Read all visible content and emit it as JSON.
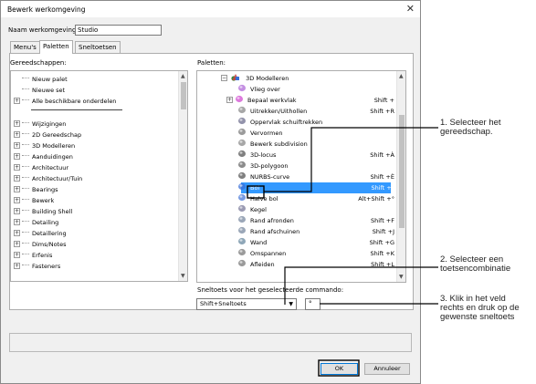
{
  "window": {
    "title": "Bewerk werkomgeving",
    "close_glyph": "✕"
  },
  "name_row": {
    "label": "Naam werkomgeving:",
    "value": "Studio"
  },
  "tabs": [
    {
      "label": "Menu's"
    },
    {
      "label": "Paletten"
    },
    {
      "label": "Sneltoetsen"
    }
  ],
  "tools_panel": {
    "label": "Gereedschappen:",
    "items": [
      {
        "label": "Nieuw palet",
        "expandable": false
      },
      {
        "label": "Nieuwe set",
        "expandable": false
      },
      {
        "label": "Alle beschikbare onderdelen",
        "expandable": true
      },
      {
        "label": "Wijzigingen",
        "expandable": true
      },
      {
        "label": "2D Gereedschap",
        "expandable": true
      },
      {
        "label": "3D Modelleren",
        "expandable": true
      },
      {
        "label": "Aanduidingen",
        "expandable": true
      },
      {
        "label": "Architectuur",
        "expandable": true
      },
      {
        "label": "Architectuur/Tuin",
        "expandable": true
      },
      {
        "label": "Bearings",
        "expandable": true
      },
      {
        "label": "Bewerk",
        "expandable": true
      },
      {
        "label": "Building Shell",
        "expandable": true
      },
      {
        "label": "Detailing",
        "expandable": true
      },
      {
        "label": "Detaillering",
        "expandable": true
      },
      {
        "label": "Dims/Notes",
        "expandable": true
      },
      {
        "label": "Erfenis",
        "expandable": true
      },
      {
        "label": "Fasteners",
        "expandable": true
      }
    ]
  },
  "palettes_panel": {
    "label": "Paletten:",
    "root": "3D Modelleren",
    "items": [
      {
        "label": "Vlieg over",
        "shortcut": "",
        "icon": "fly-over-icon",
        "expandable": false
      },
      {
        "label": "Bepaal werkvlak",
        "shortcut": "Shift +",
        "icon": "working-plane-icon",
        "expandable": true
      },
      {
        "label": "Uitrekken/Uithollen",
        "shortcut": "Shift +R",
        "icon": "extrude-icon",
        "expandable": false
      },
      {
        "label": "Oppervlak schuiftrekken",
        "shortcut": "",
        "icon": "sweep-surface-icon",
        "expandable": false
      },
      {
        "label": "Vervormen",
        "shortcut": "",
        "icon": "deform-icon",
        "expandable": false
      },
      {
        "label": "Bewerk subdivision",
        "shortcut": "",
        "icon": "subdivision-icon",
        "expandable": false
      },
      {
        "label": "3D-locus",
        "shortcut": "Shift +À",
        "icon": "locus-3d-icon",
        "expandable": false
      },
      {
        "label": "3D-polygoon",
        "shortcut": "",
        "icon": "polygon-3d-icon",
        "expandable": false
      },
      {
        "label": "NURBS-curve",
        "shortcut": "Shift +È",
        "icon": "nurbs-curve-icon",
        "expandable": false
      },
      {
        "label": "Bol",
        "shortcut": "Shift +°",
        "icon": "sphere-icon",
        "expandable": false,
        "selected": true
      },
      {
        "label": "Halve bol",
        "shortcut": "Alt+Shift +°",
        "icon": "hemisphere-icon",
        "expandable": false
      },
      {
        "label": "Kegel",
        "shortcut": "",
        "icon": "cone-icon",
        "expandable": false
      },
      {
        "label": "Rand afronden",
        "shortcut": "Shift +F",
        "icon": "fillet-edge-icon",
        "expandable": false
      },
      {
        "label": "Rand afschuinen",
        "shortcut": "Shift +J",
        "icon": "chamfer-edge-icon",
        "expandable": false
      },
      {
        "label": "Wand",
        "shortcut": "Shift +G",
        "icon": "shell-icon",
        "expandable": false
      },
      {
        "label": "Omspannen",
        "shortcut": "Shift +K",
        "icon": "loft-icon",
        "expandable": false
      },
      {
        "label": "Afleiden",
        "shortcut": "Shift +L",
        "icon": "taper-icon",
        "expandable": false
      }
    ]
  },
  "shortcut_row": {
    "label": "Sneltoets voor het geselecteerde commando:",
    "modifier_value": "Shift+Sneltoets",
    "key_value": "°"
  },
  "buttons": {
    "ok": "OK",
    "cancel": "Annuleer"
  },
  "callouts": {
    "step1": "1. Selecteer het\ngereedschap.",
    "step2": "2. Selecteer een\ntoetsencombinatie",
    "step3": "3. Klik in het veld\nrechts en druk op de\ngewenste sneltoets"
  },
  "colors": {
    "selection": "#3399ff",
    "highlight_box": "#000000"
  }
}
